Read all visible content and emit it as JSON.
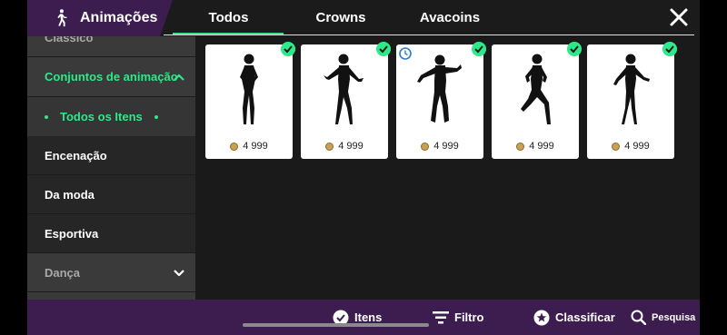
{
  "header": {
    "title": "Animações",
    "tabs": [
      {
        "label": "Todos",
        "active": true
      },
      {
        "label": "Crowns",
        "active": false
      },
      {
        "label": "Avacoins",
        "active": false
      }
    ],
    "icons": {
      "title": "person-walking-icon",
      "close": "close-icon"
    }
  },
  "sidebar": {
    "items": [
      {
        "label": "Clássico",
        "state": "collapsed-partial"
      },
      {
        "label": "Conjuntos de animação",
        "state": "expanded"
      },
      {
        "label": "Todos os Itens",
        "state": "selected"
      },
      {
        "label": "Encenação"
      },
      {
        "label": "Da moda"
      },
      {
        "label": "Esportiva"
      },
      {
        "label": "Dança",
        "state": "collapsed"
      }
    ]
  },
  "items": [
    {
      "price": "4 999",
      "owned": true,
      "figure": "standing-pose"
    },
    {
      "price": "4 999",
      "owned": true,
      "figure": "dance-pose"
    },
    {
      "price": "4 999",
      "owned": true,
      "timed": true,
      "figure": "breakdance-pose"
    },
    {
      "price": "4 999",
      "owned": true,
      "figure": "kick-pose"
    },
    {
      "price": "4 999",
      "owned": true,
      "figure": "relaxed-pose"
    }
  ],
  "bottombar": {
    "itens": "Itens",
    "filtro": "Filtro",
    "classificar": "Classificar",
    "pesquisa": "Pesquisa"
  },
  "colors": {
    "accent": "#2ee889",
    "purple": "#3d1d4f",
    "background": "#1a1a1a",
    "sidebar_item": "#262626",
    "sidebar_selected": "#353535",
    "clock_icon": "#2b7cd3",
    "coin": "#c9a055"
  }
}
